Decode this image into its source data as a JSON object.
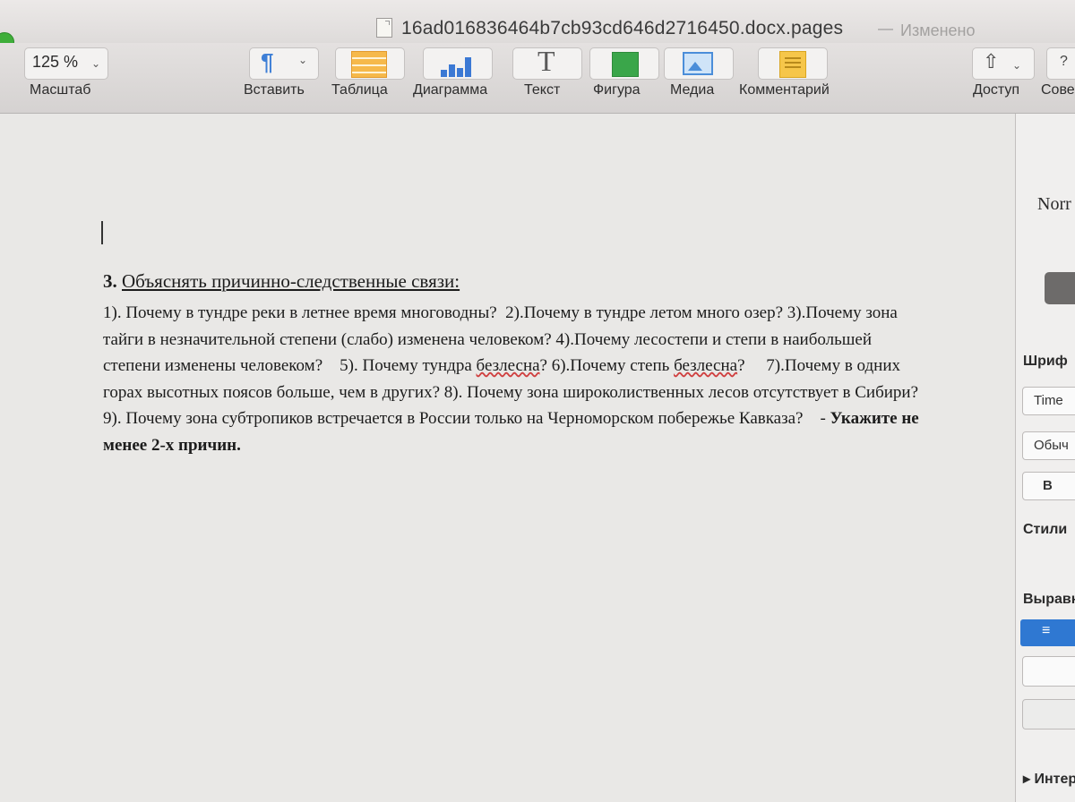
{
  "window": {
    "title": "16ad016836464b7cb93cd646d2716450.docx.pages",
    "separator": "—",
    "status": "Изменено"
  },
  "toolbar": {
    "zoom": {
      "value": "125 %",
      "label": "Масштаб"
    },
    "buttons": [
      {
        "label": "Вставить",
        "icon": "paragraph-icon"
      },
      {
        "label": "Таблица",
        "icon": "table-icon"
      },
      {
        "label": "Диаграмма",
        "icon": "chart-icon"
      },
      {
        "label": "Текст",
        "icon": "text-icon"
      },
      {
        "label": "Фигура",
        "icon": "shape-icon"
      },
      {
        "label": "Медиа",
        "icon": "media-icon"
      },
      {
        "label": "Комментарий",
        "icon": "comment-icon"
      }
    ],
    "share": {
      "label": "Доступ",
      "icon": "share-icon"
    },
    "tips": {
      "label": "Сове",
      "icon_text": "?"
    }
  },
  "document": {
    "task_number": "3.",
    "task_title": "Объяснять причинно-следственные связи:",
    "q1": "1). Почему в тундре реки в летнее время многоводны?",
    "q2": "2).Почему в тундре летом много озер?",
    "q3": "3).Почему  зона тайги в незначительной степени (слабо) изменена человеком?",
    "q4": "4).Почему лесостепи и степи в наибольшей степени изменены человеком?",
    "q5_before": "5). Почему тундра",
    "q5_squiggle": "безлесна",
    "q5_after": "?",
    "q6_before": "6).Почему степь",
    "q6_squiggle": "безлесна",
    "q6_after": "?",
    "q7": "7).Почему в одних горах высотных поясов больше, чем  в других?",
    "q8": "8). Почему зона широколиственных лесов отсутствует в Сибири?",
    "q9": "9). Почему зона субтропиков встречается в России только на Черноморском побережье Кавказа?",
    "dash": "-",
    "note": "Укажите не менее 2-х причин."
  },
  "inspector": {
    "style_name": "Norr",
    "font_label": "Шриф",
    "font_name": "Time",
    "font_style": "Обыч",
    "bold_button": "B",
    "styles_label": "Стили",
    "align_label": "Выравн",
    "align_icon": "≡",
    "more_label": "▸ Интер"
  }
}
